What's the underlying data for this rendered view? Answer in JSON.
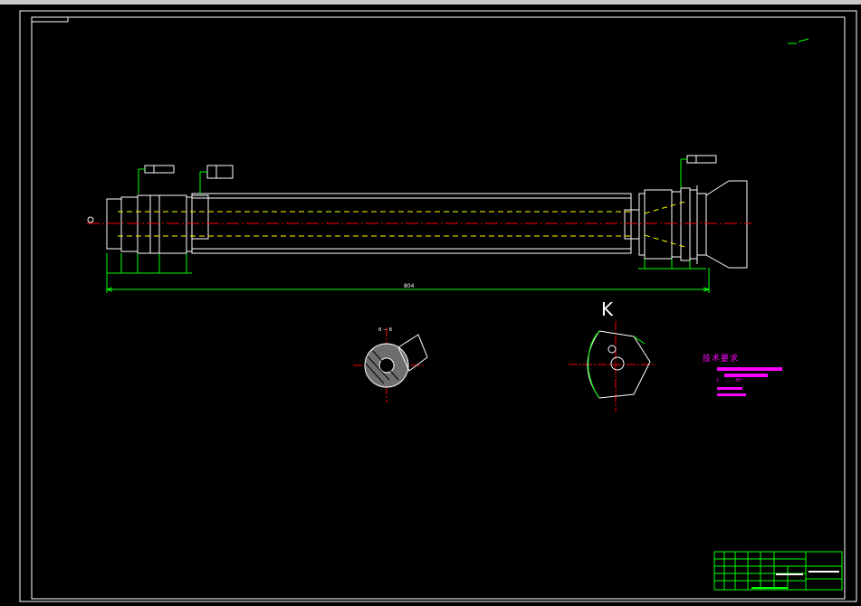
{
  "drawing": {
    "view_label": "K",
    "section_label": "B — B",
    "dimension_total_length": "804",
    "technical_notes_heading": "技术要求",
    "technical_notes_angle": "2. ... 45°"
  },
  "colors": {
    "background": "#000000",
    "outline": "#ffffff",
    "dimension": "#00ff00",
    "centerline": "#ff0000",
    "hidden": "#ffff00",
    "notes": "#ff00ff",
    "frame": "#ffffff"
  }
}
